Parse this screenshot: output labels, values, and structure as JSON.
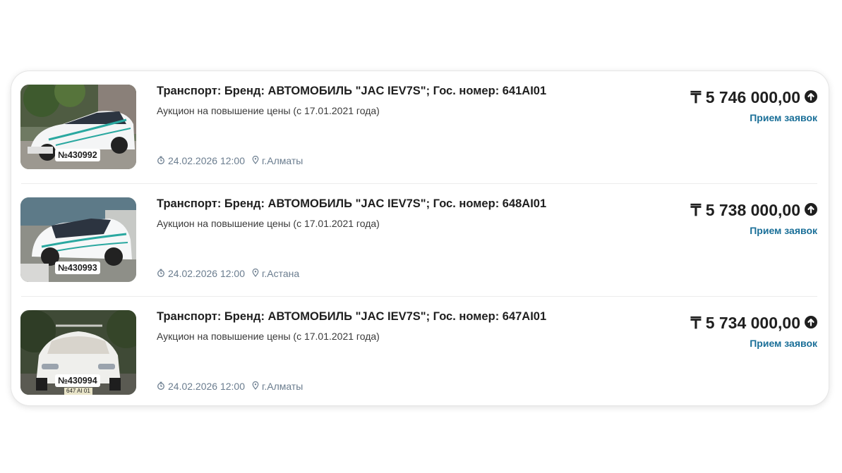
{
  "lots": [
    {
      "title": "Транспорт: Бренд: АВТОМОБИЛЬ \"JAC IEV7S\"; Гос. номер: 641AI01",
      "subtitle": "Аукцион на повышение цены (с 17.01.2021 года)",
      "date": "24.02.2026 12:00",
      "location": "г.Алматы",
      "price": "₸ 5 746 000,00",
      "status": "Прием заявок",
      "lot_number": "№430992"
    },
    {
      "title": "Транспорт: Бренд: АВТОМОБИЛЬ \"JAC IEV7S\"; Гос. номер: 648AI01",
      "subtitle": "Аукцион на повышение цены (с 17.01.2021 года)",
      "date": "24.02.2026 12:00",
      "location": "г.Астана",
      "price": "₸ 5 738 000,00",
      "status": "Прием заявок",
      "lot_number": "№430993"
    },
    {
      "title": "Транспорт: Бренд: АВТОМОБИЛЬ \"JAC IEV7S\"; Гос. номер: 647AI01",
      "subtitle": "Аукцион на повышение цены (с 17.01.2021 года)",
      "date": "24.02.2026 12:00",
      "location": "г.Алматы",
      "price": "₸ 5 734 000,00",
      "status": "Прием заявок",
      "lot_number": "№430994",
      "plate_text": "647 AI 01"
    }
  ],
  "colors": {
    "status": "#1a6f98",
    "meta": "#6b7d8f",
    "title": "#1f1f1f"
  }
}
